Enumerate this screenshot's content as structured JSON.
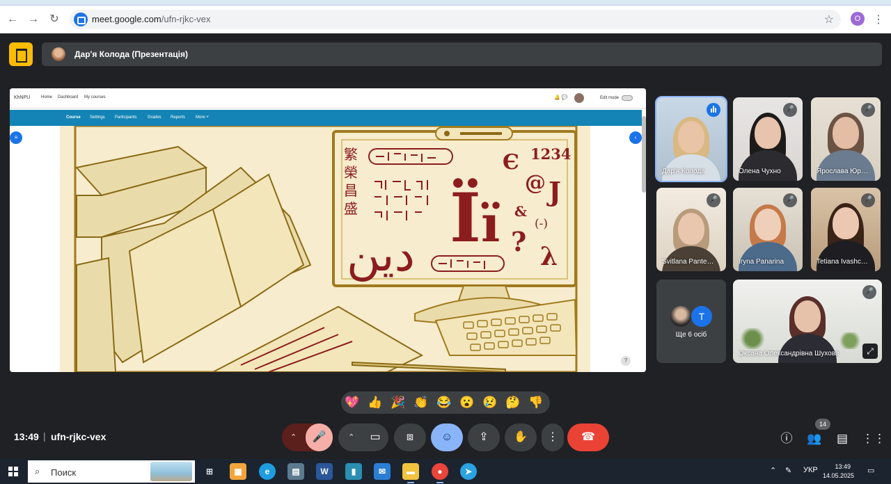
{
  "browser": {
    "url_host": "meet.google.com",
    "url_path": "/ufn-rjkc-vex",
    "profile_initial": "O"
  },
  "meet": {
    "presenter_label": "Дар'я Колода (Презентація)"
  },
  "presentation": {
    "site": {
      "logo": "KhNPU",
      "links": [
        "Home",
        "Dashboard",
        "My courses"
      ],
      "edit_mode": "Edit mode",
      "nav": [
        "Course",
        "Settings",
        "Participants",
        "Grades",
        "Reports",
        "More ˅"
      ],
      "help": "?"
    },
    "slide": {
      "characters": [
        "繁",
        "榮",
        "昌",
        "盛",
        "1234",
        "Ї",
        "ї",
        "@",
        "J",
        "&",
        "?",
        "(-)",
        "λ",
        "Є",
        "دين"
      ]
    }
  },
  "participants": [
    {
      "name": "Дар'я Колода",
      "state": "speaking"
    },
    {
      "name": "Олена Чухно",
      "state": "muted"
    },
    {
      "name": "Ярослава Юр…",
      "state": "muted"
    },
    {
      "name": "Svitlana Pante…",
      "state": "muted"
    },
    {
      "name": "Iryna Panarina",
      "state": "muted"
    },
    {
      "name": "Tetiana Ivashc…",
      "state": "muted"
    },
    {
      "name": "Оксана Олександрівна Шухова",
      "state": "muted"
    }
  ],
  "more_participants": {
    "label": "Ще 6 осіб",
    "avatar_letter": "T"
  },
  "reactions": [
    "💖",
    "👍",
    "🎉",
    "👏",
    "😂",
    "😮",
    "😢",
    "🤔",
    "👎"
  ],
  "controls": {
    "time": "13:49",
    "separator": "|",
    "meeting_code": "ufn-rjkc-vex",
    "participants_badge": "14"
  },
  "taskbar": {
    "search_text": "Поиск",
    "language": "УКР",
    "time": "13:49",
    "date": "14.05.2025"
  },
  "colors": {
    "meet_bg": "#202124",
    "end_call": "#ea4335",
    "reactions_active": "#8ab4f8",
    "muted_mic": "#f6aea9",
    "slide_bg": "#f7eccd",
    "slide_ink": "#8b1d1d"
  }
}
